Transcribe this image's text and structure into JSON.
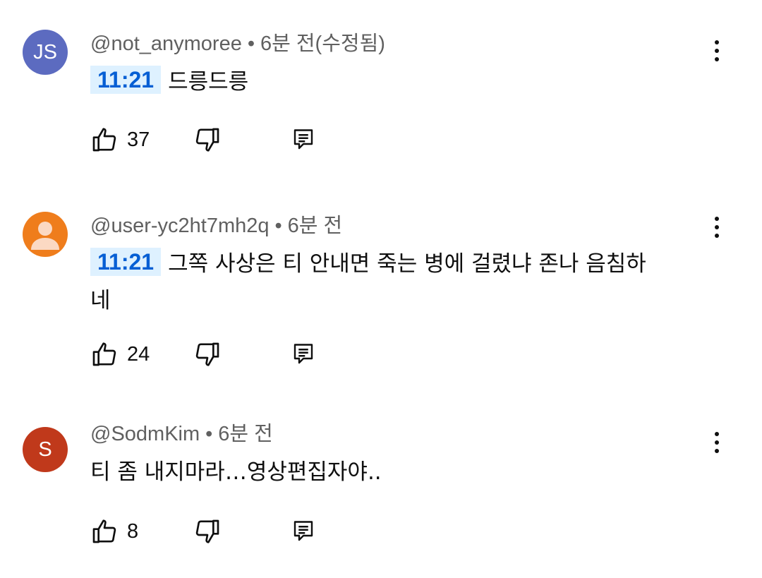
{
  "comments": [
    {
      "author": "@not_anymoree",
      "separator": "•",
      "time": "6분 전(수정됨)",
      "avatar_text": "JS",
      "avatar_color": "#5c6bc0",
      "timestamp_link": "11:21",
      "text": "드릉드릉",
      "like_count": "37"
    },
    {
      "author": "@user-yc2ht7mh2q",
      "separator": "•",
      "time": "6분 전",
      "avatar_text": "",
      "avatar_color": "#ef7d1c",
      "timestamp_link": "11:21",
      "text": "그쪽 사상은 티 안내면 죽는 병에 걸렸냐 존나 음침하네",
      "like_count": "24"
    },
    {
      "author": "@SodmKim",
      "separator": "•",
      "time": "6분 전",
      "avatar_text": "S",
      "avatar_color": "#c0391b",
      "timestamp_link": "",
      "text": "티 좀 내지마라…영상편집자야..",
      "like_count": "8"
    }
  ],
  "icons": {
    "more": "more-vertical-icon",
    "like": "thumb-up-icon",
    "dislike": "thumb-down-icon",
    "reply": "reply-comment-icon",
    "default_avatar": "default-user-avatar-icon"
  }
}
